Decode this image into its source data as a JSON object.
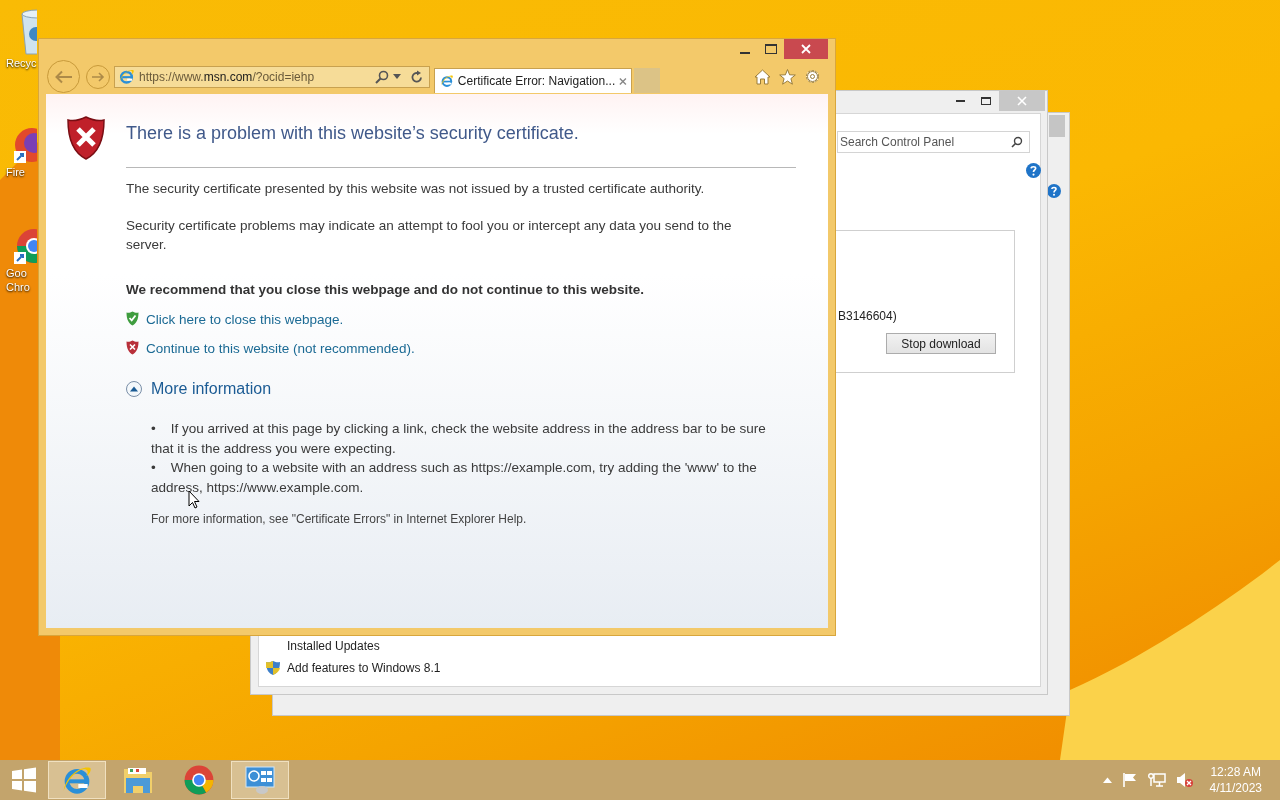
{
  "desktop_icons": [
    {
      "kind": "recycle_bin",
      "lines": [
        "Recyc"
      ]
    },
    {
      "kind": "firefox",
      "lines": [
        "Fire"
      ]
    },
    {
      "kind": "chrome",
      "lines": [
        "Goo",
        "Chro"
      ]
    }
  ],
  "control_panel": {
    "search": {
      "placeholder": "Search Control Panel"
    },
    "update_text": "B3146604)",
    "stop_button": "Stop download",
    "links": [
      {
        "kind": "plain",
        "label": "Installed Updates"
      },
      {
        "kind": "shield",
        "label": "Add features to Windows 8.1"
      }
    ]
  },
  "browser": {
    "address": {
      "scheme": "https://www.",
      "host": "msn.com",
      "path": "/?ocid=iehp"
    },
    "tabs": [
      {
        "title": "Certificate Error: Navigation...",
        "selected": true
      }
    ],
    "page": {
      "heading": "There is a problem with this website’s security certificate.",
      "paragraphs": [
        "The security certificate presented by this website was not issued by a trusted certificate authority.",
        "Security certificate problems may indicate an attempt to fool you or intercept any data you send to the server."
      ],
      "recommendation": "We recommend that you close this webpage and do not continue to this website.",
      "actions": [
        {
          "kind": "safe",
          "label": "Click here to close this webpage."
        },
        {
          "kind": "unsafe",
          "label": "Continue to this website (not recommended)."
        }
      ],
      "more_info": {
        "label": "More information",
        "expanded": true,
        "bullet_mark": "•",
        "bullets": [
          "If you arrived at this page by clicking a link, check the website address in the address bar to be sure that it is the address you were expecting.",
          "When going to a website with an address such as https://example.com, try adding the 'www' to the address, https://www.example.com."
        ],
        "footer": "For more information, see \"Certificate Errors\" in Internet Explorer Help."
      }
    }
  },
  "taskbar": {
    "items": [
      {
        "kind": "start",
        "running": false
      },
      {
        "kind": "ie",
        "running": true
      },
      {
        "kind": "explorer",
        "running": false
      },
      {
        "kind": "chrome",
        "running": false
      },
      {
        "kind": "control_panel",
        "running": true
      }
    ],
    "clock": {
      "time": "12:28 AM",
      "date": "4/11/2023"
    }
  }
}
